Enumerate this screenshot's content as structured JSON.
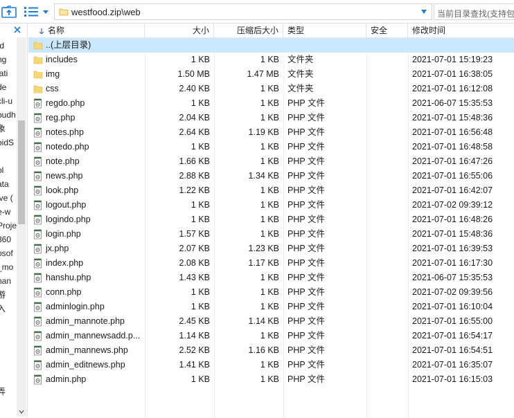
{
  "toolbar": {
    "path": "westfood.zip\\web",
    "search_placeholder": "当前目录查找(支持包"
  },
  "left_pane": {
    "items": [
      ".d",
      "ng",
      "lati",
      "de",
      "cli-u",
      "oudh",
      "象",
      "oidS",
      "",
      "ol",
      "ata",
      "ive (",
      "e-w",
      "Proje",
      "360",
      "osof",
      "_mo",
      "nan",
      "游",
      "入",
      "",
      "",
      "",
      "",
      "",
      "弄"
    ]
  },
  "columns": {
    "name": "名称",
    "size": "大小",
    "compressed": "压缩后大小",
    "type": "类型",
    "security": "安全",
    "modified": "修改时间"
  },
  "parent_row": {
    "name": "..(上层目录)"
  },
  "files": [
    {
      "name": "includes",
      "size": "1 KB",
      "compressed": "1 KB",
      "type": "文件夹",
      "modified": "2021-07-01 15:19:23",
      "kind": "folder"
    },
    {
      "name": "img",
      "size": "1.50 MB",
      "compressed": "1.47 MB",
      "type": "文件夹",
      "modified": "2021-07-01 16:38:05",
      "kind": "folder"
    },
    {
      "name": "css",
      "size": "2.40 KB",
      "compressed": "1 KB",
      "type": "文件夹",
      "modified": "2021-07-01 16:12:08",
      "kind": "folder"
    },
    {
      "name": "regdo.php",
      "size": "1 KB",
      "compressed": "1 KB",
      "type": "PHP 文件",
      "modified": "2021-06-07 15:35:53",
      "kind": "php"
    },
    {
      "name": "reg.php",
      "size": "2.04 KB",
      "compressed": "1 KB",
      "type": "PHP 文件",
      "modified": "2021-07-01 15:48:36",
      "kind": "php"
    },
    {
      "name": "notes.php",
      "size": "2.64 KB",
      "compressed": "1.19 KB",
      "type": "PHP 文件",
      "modified": "2021-07-01 16:56:48",
      "kind": "php"
    },
    {
      "name": "notedo.php",
      "size": "1 KB",
      "compressed": "1 KB",
      "type": "PHP 文件",
      "modified": "2021-07-01 16:48:58",
      "kind": "php"
    },
    {
      "name": "note.php",
      "size": "1.66 KB",
      "compressed": "1 KB",
      "type": "PHP 文件",
      "modified": "2021-07-01 16:47:26",
      "kind": "php"
    },
    {
      "name": "news.php",
      "size": "2.88 KB",
      "compressed": "1.34 KB",
      "type": "PHP 文件",
      "modified": "2021-07-01 16:55:06",
      "kind": "php"
    },
    {
      "name": "look.php",
      "size": "1.22 KB",
      "compressed": "1 KB",
      "type": "PHP 文件",
      "modified": "2021-07-01 16:42:07",
      "kind": "php"
    },
    {
      "name": "logout.php",
      "size": "1 KB",
      "compressed": "1 KB",
      "type": "PHP 文件",
      "modified": "2021-07-02 09:39:12",
      "kind": "php"
    },
    {
      "name": "logindo.php",
      "size": "1 KB",
      "compressed": "1 KB",
      "type": "PHP 文件",
      "modified": "2021-07-01 16:48:26",
      "kind": "php"
    },
    {
      "name": "login.php",
      "size": "1.57 KB",
      "compressed": "1 KB",
      "type": "PHP 文件",
      "modified": "2021-07-01 15:48:36",
      "kind": "php"
    },
    {
      "name": "jx.php",
      "size": "2.07 KB",
      "compressed": "1.23 KB",
      "type": "PHP 文件",
      "modified": "2021-07-01 16:39:53",
      "kind": "php"
    },
    {
      "name": "index.php",
      "size": "2.08 KB",
      "compressed": "1.17 KB",
      "type": "PHP 文件",
      "modified": "2021-07-01 16:17:30",
      "kind": "php"
    },
    {
      "name": "hanshu.php",
      "size": "1.43 KB",
      "compressed": "1 KB",
      "type": "PHP 文件",
      "modified": "2021-06-07 15:35:53",
      "kind": "php"
    },
    {
      "name": "conn.php",
      "size": "1 KB",
      "compressed": "1 KB",
      "type": "PHP 文件",
      "modified": "2021-07-02 09:39:56",
      "kind": "php"
    },
    {
      "name": "adminlogin.php",
      "size": "1 KB",
      "compressed": "1 KB",
      "type": "PHP 文件",
      "modified": "2021-07-01 16:10:04",
      "kind": "php"
    },
    {
      "name": "admin_mannote.php",
      "size": "2.45 KB",
      "compressed": "1.14 KB",
      "type": "PHP 文件",
      "modified": "2021-07-01 16:55:00",
      "kind": "php"
    },
    {
      "name": "admin_mannewsadd.p...",
      "size": "1.14 KB",
      "compressed": "1 KB",
      "type": "PHP 文件",
      "modified": "2021-07-01 16:54:17",
      "kind": "php"
    },
    {
      "name": "admin_mannews.php",
      "size": "2.52 KB",
      "compressed": "1.16 KB",
      "type": "PHP 文件",
      "modified": "2021-07-01 16:54:51",
      "kind": "php"
    },
    {
      "name": "admin_editnews.php",
      "size": "1.41 KB",
      "compressed": "1 KB",
      "type": "PHP 文件",
      "modified": "2021-07-01 16:35:07",
      "kind": "php"
    },
    {
      "name": "admin.php",
      "size": "1 KB",
      "compressed": "1 KB",
      "type": "PHP 文件",
      "modified": "2021-07-01 16:15:03",
      "kind": "php"
    }
  ],
  "colors": {
    "selection": "#cce8ff",
    "folder": "#f2c84b",
    "accent_blue": "#1e7bd7"
  }
}
